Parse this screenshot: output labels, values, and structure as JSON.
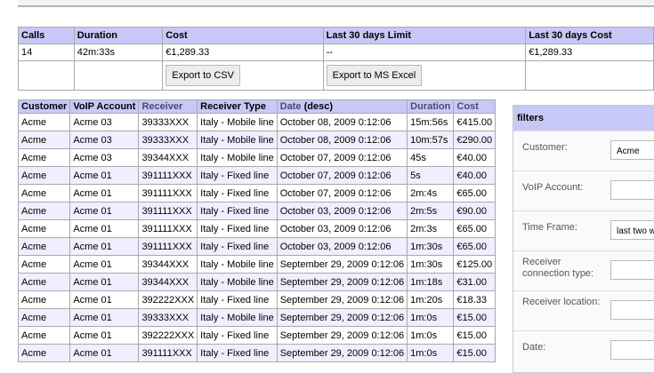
{
  "summary": {
    "headers": [
      "Calls",
      "Duration",
      "Cost",
      "Last 30 days Limit",
      "Last 30 days Cost"
    ],
    "values": [
      "14",
      "42m:33s",
      "€1,289.33",
      "--",
      "€1,289.33"
    ],
    "export_csv": "Export to CSV",
    "export_excel": "Export to MS Excel"
  },
  "calls": {
    "headers": {
      "customer": "Customer",
      "voip": "VoIP Account",
      "receiver": "Receiver",
      "receiver_type": "Receiver Type",
      "date": "Date",
      "date_sort": "(desc)",
      "duration": "Duration",
      "cost": "Cost"
    },
    "rows": [
      [
        "Acme",
        "Acme 03",
        "39333XXX",
        "Italy - Mobile line",
        "October 08, 2009 0:12:06",
        "15m:56s",
        "€415.00"
      ],
      [
        "Acme",
        "Acme 03",
        "39333XXX",
        "Italy - Mobile line",
        "October 08, 2009 0:12:06",
        "10m:57s",
        "€290.00"
      ],
      [
        "Acme",
        "Acme 03",
        "39344XXX",
        "Italy - Mobile line",
        "October 07, 2009 0:12:06",
        "45s",
        "€40.00"
      ],
      [
        "Acme",
        "Acme 01",
        "391111XXX",
        "Italy - Fixed line",
        "October 07, 2009 0:12:06",
        "5s",
        "€40.00"
      ],
      [
        "Acme",
        "Acme 01",
        "391111XXX",
        "Italy - Fixed line",
        "October 07, 2009 0:12:06",
        "2m:4s",
        "€65.00"
      ],
      [
        "Acme",
        "Acme 01",
        "391111XXX",
        "Italy - Fixed line",
        "October 03, 2009 0:12:06",
        "2m:5s",
        "€90.00"
      ],
      [
        "Acme",
        "Acme 01",
        "391111XXX",
        "Italy - Fixed line",
        "October 03, 2009 0:12:06",
        "2m:3s",
        "€65.00"
      ],
      [
        "Acme",
        "Acme 01",
        "391111XXX",
        "Italy - Fixed line",
        "October 03, 2009 0:12:06",
        "1m:30s",
        "€65.00"
      ],
      [
        "Acme",
        "Acme 01",
        "39344XXX",
        "Italy - Mobile line",
        "September 29, 2009 0:12:06",
        "1m:30s",
        "€125.00"
      ],
      [
        "Acme",
        "Acme 01",
        "39344XXX",
        "Italy - Mobile line",
        "September 29, 2009 0:12:06",
        "1m:18s",
        "€31.00"
      ],
      [
        "Acme",
        "Acme 01",
        "392222XXX",
        "Italy - Fixed line",
        "September 29, 2009 0:12:06",
        "1m:20s",
        "€18.33"
      ],
      [
        "Acme",
        "Acme 01",
        "39333XXX",
        "Italy - Mobile line",
        "September 29, 2009 0:12:06",
        "1m:0s",
        "€15.00"
      ],
      [
        "Acme",
        "Acme 01",
        "392222XXX",
        "Italy - Fixed line",
        "September 29, 2009 0:12:06",
        "1m:0s",
        "€15.00"
      ],
      [
        "Acme",
        "Acme 01",
        "391111XXX",
        "Italy - Fixed line",
        "September 29, 2009 0:12:06",
        "1m:0s",
        "€15.00"
      ]
    ]
  },
  "filters": {
    "title": "filters",
    "customer_label": "Customer:",
    "customer_value": "Acme",
    "voip_label": "VoIP Account:",
    "timeframe_label": "Time Frame:",
    "timeframe_value": "last two w",
    "conn_type_label": "Receiver connection type:",
    "location_label": "Receiver location:",
    "date_label": "Date:"
  }
}
